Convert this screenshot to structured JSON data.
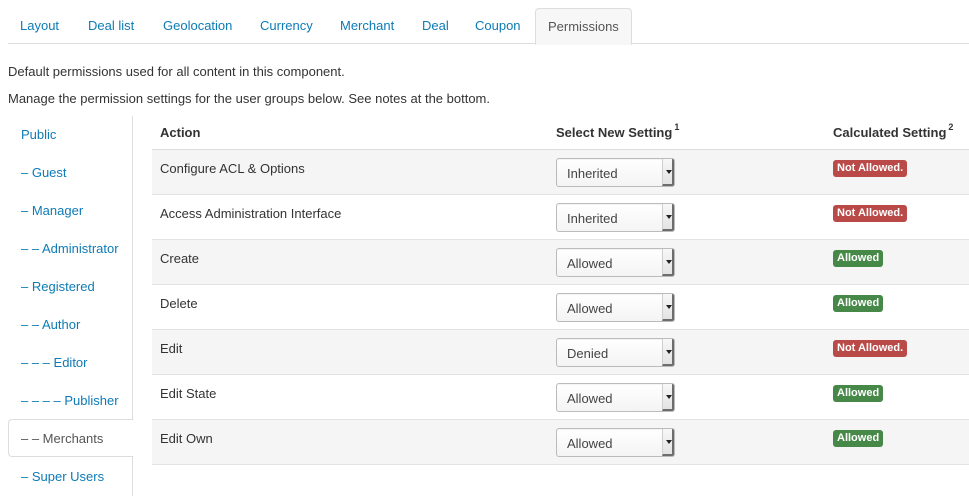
{
  "tabs": [
    {
      "label": "Layout"
    },
    {
      "label": "Deal list"
    },
    {
      "label": "Geolocation"
    },
    {
      "label": "Currency"
    },
    {
      "label": "Merchant"
    },
    {
      "label": "Deal"
    },
    {
      "label": "Coupon"
    },
    {
      "label": "Permissions",
      "active": true
    }
  ],
  "intro": {
    "line1": "Default permissions used for all content in this component.",
    "line2": "Manage the permission settings for the user groups below. See notes at the bottom."
  },
  "groups": [
    {
      "label": "Public"
    },
    {
      "label": "– Guest"
    },
    {
      "label": "– Manager"
    },
    {
      "label": "– – Administrator"
    },
    {
      "label": "– Registered"
    },
    {
      "label": "– – Author"
    },
    {
      "label": "– – – Editor"
    },
    {
      "label": "– – – – Publisher"
    },
    {
      "label": "– – Merchants",
      "active": true
    },
    {
      "label": "– Super Users"
    }
  ],
  "table": {
    "headers": {
      "action": "Action",
      "new_setting": "Select New Setting",
      "new_setting_note": "1",
      "calculated": "Calculated Setting",
      "calculated_note": "2"
    },
    "rows": [
      {
        "action": "Configure ACL & Options",
        "setting": "Inherited",
        "calculated": "Not Allowed."
      },
      {
        "action": "Access Administration Interface",
        "setting": "Inherited",
        "calculated": "Not Allowed."
      },
      {
        "action": "Create",
        "setting": "Allowed",
        "calculated": "Allowed"
      },
      {
        "action": "Delete",
        "setting": "Allowed",
        "calculated": "Allowed"
      },
      {
        "action": "Edit",
        "setting": "Denied",
        "calculated": "Not Allowed."
      },
      {
        "action": "Edit State",
        "setting": "Allowed",
        "calculated": "Allowed"
      },
      {
        "action": "Edit Own",
        "setting": "Allowed",
        "calculated": "Allowed"
      }
    ]
  },
  "colors": {
    "link": "#0d7bb5",
    "allowed": "#468847",
    "not_allowed": "#b94a48"
  },
  "icons": {
    "select_arrow": "chevron-down-icon"
  }
}
